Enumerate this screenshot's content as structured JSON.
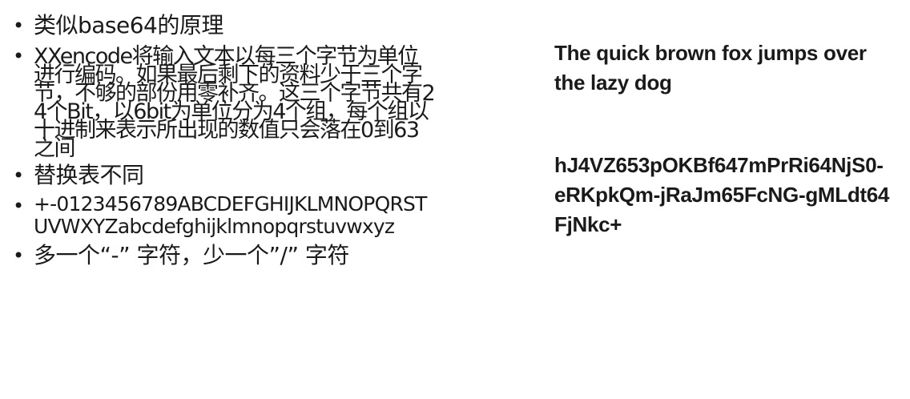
{
  "bullets": [
    {
      "marker": "•",
      "text": "类似base64的原理"
    },
    {
      "marker": "•",
      "text": "XXencode将输入文本以每三个字节为单位进行编码。如果最后剩下的资料少于三个字节，不够的部份用零补齐。这三个字节共有24个Bit，以6bit为单位分为4个组，每个组以十进制来表示所出现的数值只会落在0到63之间"
    },
    {
      "marker": "•",
      "text": "替换表不同"
    },
    {
      "marker": "•",
      "text": "+-0123456789ABCDEFGHIJKLMNOPQRSTUVWXYZabcdefghijklmnopqrstuvwxyz"
    },
    {
      "marker": "•",
      "text": "多一个“-” 字符，少一个”/” 字符"
    }
  ],
  "example": {
    "plain_text": "The quick brown fox jumps over the lazy dog",
    "encoded_text": "hJ4VZ653pOKBf647mPrRi64NjS0-eRKpkQm-jRaJm65FcNG-gMLdt64FjNkc+"
  }
}
